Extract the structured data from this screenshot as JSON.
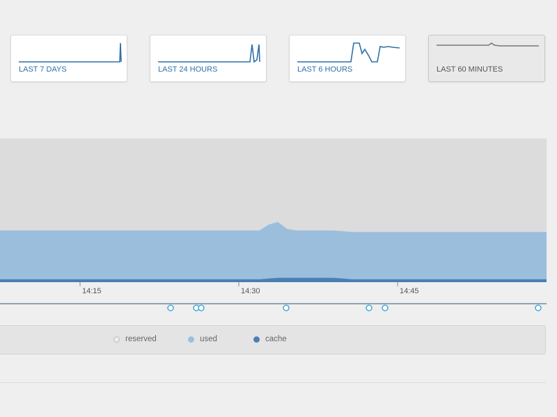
{
  "range_cards": [
    {
      "label": "LAST 7 DAYS",
      "active": false
    },
    {
      "label": "LAST 24 HOURS",
      "active": false
    },
    {
      "label": "LAST 6 HOURS",
      "active": false
    },
    {
      "label": "LAST 60 MINUTES",
      "active": true
    }
  ],
  "colors": {
    "accent": "#2e6fa8",
    "used": "#9bbedd",
    "cache": "#4a7fb5",
    "reserved": "#dcdcdc",
    "event_marker": "#2a9fd6"
  },
  "chart_data": {
    "type": "area",
    "x_ticks": [
      "14:15",
      "14:30",
      "14:45"
    ],
    "series": [
      {
        "name": "reserved",
        "values": [
          100,
          100,
          100,
          100,
          100,
          100,
          100,
          100,
          100,
          100,
          100,
          100,
          100,
          100,
          100,
          100,
          100,
          100,
          100,
          100,
          100,
          100,
          100,
          100,
          100,
          100,
          100,
          100,
          100,
          100,
          100,
          100,
          100,
          100,
          100,
          100,
          100,
          100,
          100,
          100,
          100,
          100,
          100,
          100,
          100,
          100,
          100,
          100,
          100,
          100,
          100,
          100,
          100,
          100,
          100,
          100,
          100,
          100,
          100,
          100
        ]
      },
      {
        "name": "used",
        "values": [
          36,
          36,
          36,
          36,
          36,
          36,
          36,
          36,
          36,
          36,
          36,
          36,
          36,
          36,
          36,
          36,
          36,
          36,
          36,
          36,
          36,
          36,
          36,
          36,
          36,
          36,
          36,
          36,
          36,
          40,
          42,
          37,
          36,
          36,
          36,
          36,
          36,
          35.5,
          35,
          35,
          35,
          35,
          35,
          35,
          35,
          35,
          35,
          35,
          35,
          35,
          35,
          35,
          35,
          35,
          35,
          35,
          35,
          35,
          35,
          35
        ]
      },
      {
        "name": "cache",
        "values": [
          2,
          2,
          2,
          2,
          2,
          2,
          2,
          2,
          2,
          2,
          2,
          2,
          2,
          2,
          2,
          2,
          2,
          2,
          2,
          2,
          2,
          2,
          2,
          2,
          2,
          2,
          2,
          2,
          2,
          2.5,
          3,
          3,
          3,
          3,
          3,
          3,
          3,
          2.5,
          2,
          2,
          2,
          2,
          2,
          2,
          2,
          2,
          2,
          2,
          2,
          2,
          2,
          2,
          2,
          2,
          2,
          2,
          2,
          2,
          2,
          2
        ]
      }
    ],
    "grid": true,
    "legend": "bottom-center",
    "ylim": [
      0,
      120
    ]
  },
  "legend": [
    {
      "name": "reserved",
      "color": "#dcdcdc"
    },
    {
      "name": "used",
      "color": "#9bbedd"
    },
    {
      "name": "cache",
      "color": "#4a7fb5"
    }
  ]
}
